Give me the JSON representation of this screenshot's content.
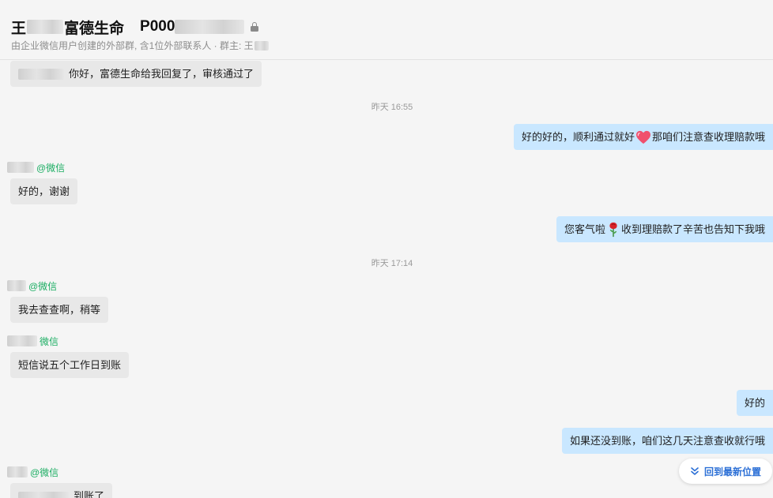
{
  "header": {
    "title_start": "王",
    "title_company": "富德生命",
    "title_code": "P000",
    "subtitle": "由企业微信用户创建的外部群, 含1位外部联系人 · 群主: 王"
  },
  "messages": {
    "m1": {
      "text": "你好，富德生命给我回复了，审核通过了"
    },
    "t1": "昨天 16:55",
    "m2": {
      "text_a": "好的好的，顺利通过就好",
      "text_b": "那咱们注意查收理赔款哦"
    },
    "s1": {
      "tag": "@微信"
    },
    "m3": {
      "text": "好的，谢谢"
    },
    "m4": {
      "text_a": "您客气啦",
      "text_b": "收到理赔款了辛苦也告知下我哦"
    },
    "t2": "昨天 17:14",
    "s2": {
      "tag": "@微信"
    },
    "m5": {
      "text": "我去查查啊，稍等"
    },
    "s3": {
      "tag": "微信"
    },
    "m6": {
      "text": "短信说五个工作日到账"
    },
    "m7": {
      "text": "好的"
    },
    "m8": {
      "text": "如果还没到账，咱们这几天注意查收就行哦"
    },
    "s4": {
      "tag": "@微信"
    },
    "m9": {
      "text": "到账了"
    }
  },
  "jump": {
    "label": "回到最新位置"
  },
  "colors": {
    "incoming": "#e8e8e8",
    "outgoing": "#c9e7ff",
    "wechat_tag": "#1aad62",
    "jump_text": "#2b6fd6"
  }
}
